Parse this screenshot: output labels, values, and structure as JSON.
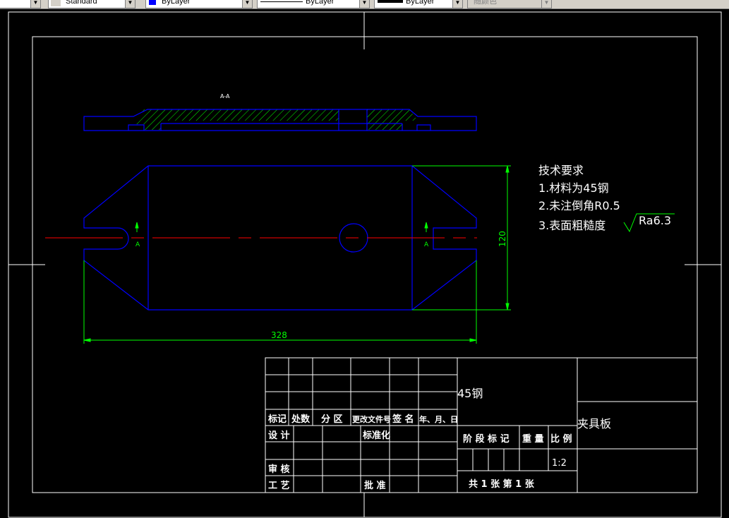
{
  "toolbar": {
    "text_style": "Standard",
    "layer_color": "ByLayer",
    "linetype": "ByLayer",
    "lineweight": "ByLayer",
    "plot_style": "随颜色"
  },
  "colors": {
    "background": "#000000",
    "frame": "#ffffff",
    "outline": "#0000ff",
    "centerline": "#ff0000",
    "hatch": "#00ff00",
    "dimension": "#00ff00"
  },
  "drawing": {
    "section_label": "A-A",
    "arrow_label_left": "A",
    "arrow_label_right": "A",
    "dim_width": "328",
    "dim_height": "120"
  },
  "notes": {
    "title": "技术要求",
    "line1": "1.材料为45钢",
    "line2": "2.未注倒角R0.5",
    "line3": "3.表面粗糙度",
    "roughness": "Ra6.3"
  },
  "title_block": {
    "material": "45钢",
    "part_name": "夹具板",
    "header_mark": "标记",
    "header_count": "处数",
    "header_zone": "分 区",
    "header_doc": "更改文件号",
    "header_sign": "签 名",
    "header_date": "年、月、日",
    "design": "设 计",
    "standardize": "标准化",
    "review": "审 核",
    "process": "工 艺",
    "approve": "批 准",
    "stage_mark": "阶 段 标 记",
    "weight": "重 量",
    "scale_label": "比 例",
    "scale_value": "1:2",
    "sheets": "共 1 张  第 1 张"
  }
}
